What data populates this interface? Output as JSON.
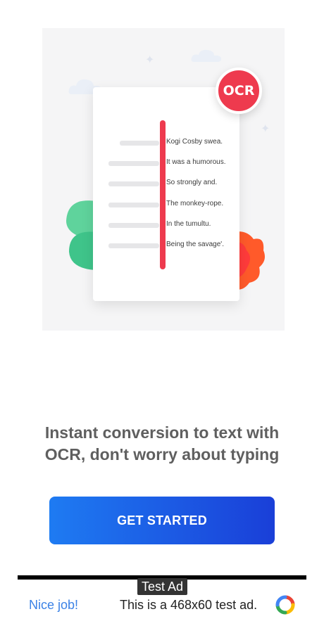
{
  "illustration": {
    "badge_text": "OCR",
    "recognized_lines": [
      "Kogi Cosby swea.",
      "It was a humorous.",
      "So strongly and.",
      "The monkey-rope.",
      "In the tumultu.",
      "Being the savage'."
    ]
  },
  "onboarding": {
    "tagline": "Instant conversion to text with OCR, don't worry about typing",
    "cta_label": "GET STARTED"
  },
  "ad": {
    "tag": "Test Ad",
    "left_text": "Nice job!",
    "middle_text": "This is a 468x60 test ad.",
    "logo_icon": "adsense-logo-icon"
  },
  "colors": {
    "accent_red": "#ee3a4e",
    "button_gradient_start": "#1e7bf2",
    "button_gradient_end": "#1a3fd8",
    "link_blue": "#3b82e6",
    "leaf_green": "#3fc48a",
    "leaf_orange": "#ff5a2a"
  }
}
